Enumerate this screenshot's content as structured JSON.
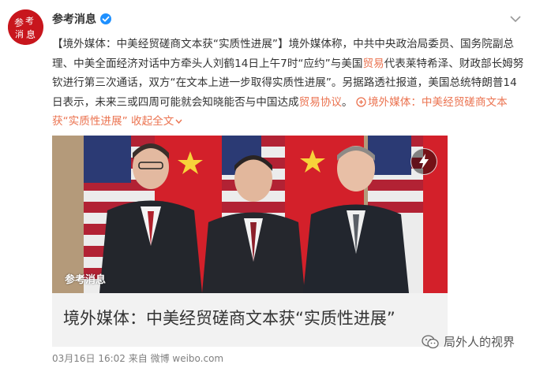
{
  "author": {
    "name": "参考消息",
    "avatar_text": "参考消息",
    "verified": true
  },
  "post": {
    "headline": "【境外媒体：中美经贸磋商文本获“实质性进展”】",
    "body_1": "境外媒体称，中共中央政治局委员、国务院副总理、中美全面经济对话中方牵头人刘鹤14日上午7时“应约”与美国",
    "keyword_1": "贸易",
    "body_2": "代表莱特希泽、财政部长姆努钦进行第三次通话，双方“在文本上进一步取得实质性进展”。另据路透社报道，美国总统特朗普14日表示，未来三或四周可能就会知晓能否与中国达成",
    "keyword_2": "贸易协议",
    "body_3": "。",
    "link_text": "境外媒体：中美经贸磋商文本获“实质性进展”",
    "collapse_text": "收起全文"
  },
  "card": {
    "watermark": "参考消息",
    "title": "境外媒体：中美经贸磋商文本获“实质性进展”"
  },
  "footer": {
    "meta": "03月16日 16:02 来自 微博 weibo.com"
  },
  "account_watermark": {
    "text": "局外人的视界"
  },
  "colors": {
    "accent": "#eb7350",
    "link": "#eb7350",
    "brand_red": "#c8161d",
    "text": "#333333",
    "meta": "#808080"
  },
  "icons": [
    "verified-icon",
    "menu-chevron-icon",
    "link-icon",
    "chevron-down-icon",
    "bolt-icon",
    "wechat-icon"
  ]
}
